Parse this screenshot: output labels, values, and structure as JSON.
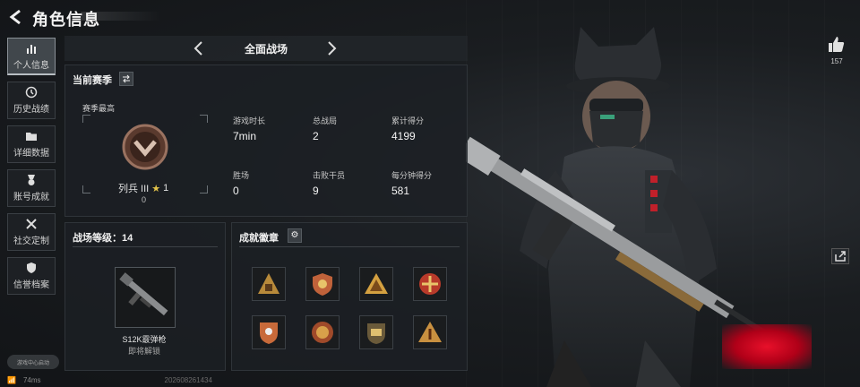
{
  "header": {
    "title": "角色信息"
  },
  "sidebar": {
    "items": [
      {
        "label": "个人信息",
        "icon": "bar-chart-icon",
        "active": true
      },
      {
        "label": "历史战绩",
        "icon": "clock-icon",
        "active": false
      },
      {
        "label": "详细数据",
        "icon": "folder-icon",
        "active": false
      },
      {
        "label": "账号成就",
        "icon": "medal-icon",
        "active": false
      },
      {
        "label": "社交定制",
        "icon": "tools-icon",
        "active": false
      },
      {
        "label": "信誉档案",
        "icon": "shield-icon",
        "active": false
      }
    ],
    "footer_label": "游戏中心启动"
  },
  "status": {
    "ping": "74ms",
    "uid": "202608261434"
  },
  "mode": {
    "title": "全面战场"
  },
  "season": {
    "title": "当前赛季",
    "best_label": "赛季最高",
    "rank_name": "列兵 III",
    "stars": "1",
    "rank_points": "0",
    "stats": [
      {
        "label": "游戏时长",
        "value": "7min"
      },
      {
        "label": "总战局",
        "value": "2"
      },
      {
        "label": "累计得分",
        "value": "4199"
      },
      {
        "label": "胜场",
        "value": "0"
      },
      {
        "label": "击败干员",
        "value": "9"
      },
      {
        "label": "每分钟得分",
        "value": "581"
      }
    ]
  },
  "battlefield": {
    "title": "战场等级：14",
    "weapon_name": "S12K霰弹枪",
    "weapon_status": "即将解锁"
  },
  "achievements": {
    "title": "成就徽章",
    "badges": [
      "pyramid-badge",
      "shield-star-badge",
      "gold-triangle-badge",
      "round-cross-badge",
      "crest-badge",
      "medal-badge",
      "wreath-badge",
      "triangle-one-badge"
    ]
  },
  "social": {
    "likes": "157"
  },
  "colors": {
    "accent": "#e8102a",
    "panel": "#1c2024",
    "text": "#e6e6e6"
  }
}
